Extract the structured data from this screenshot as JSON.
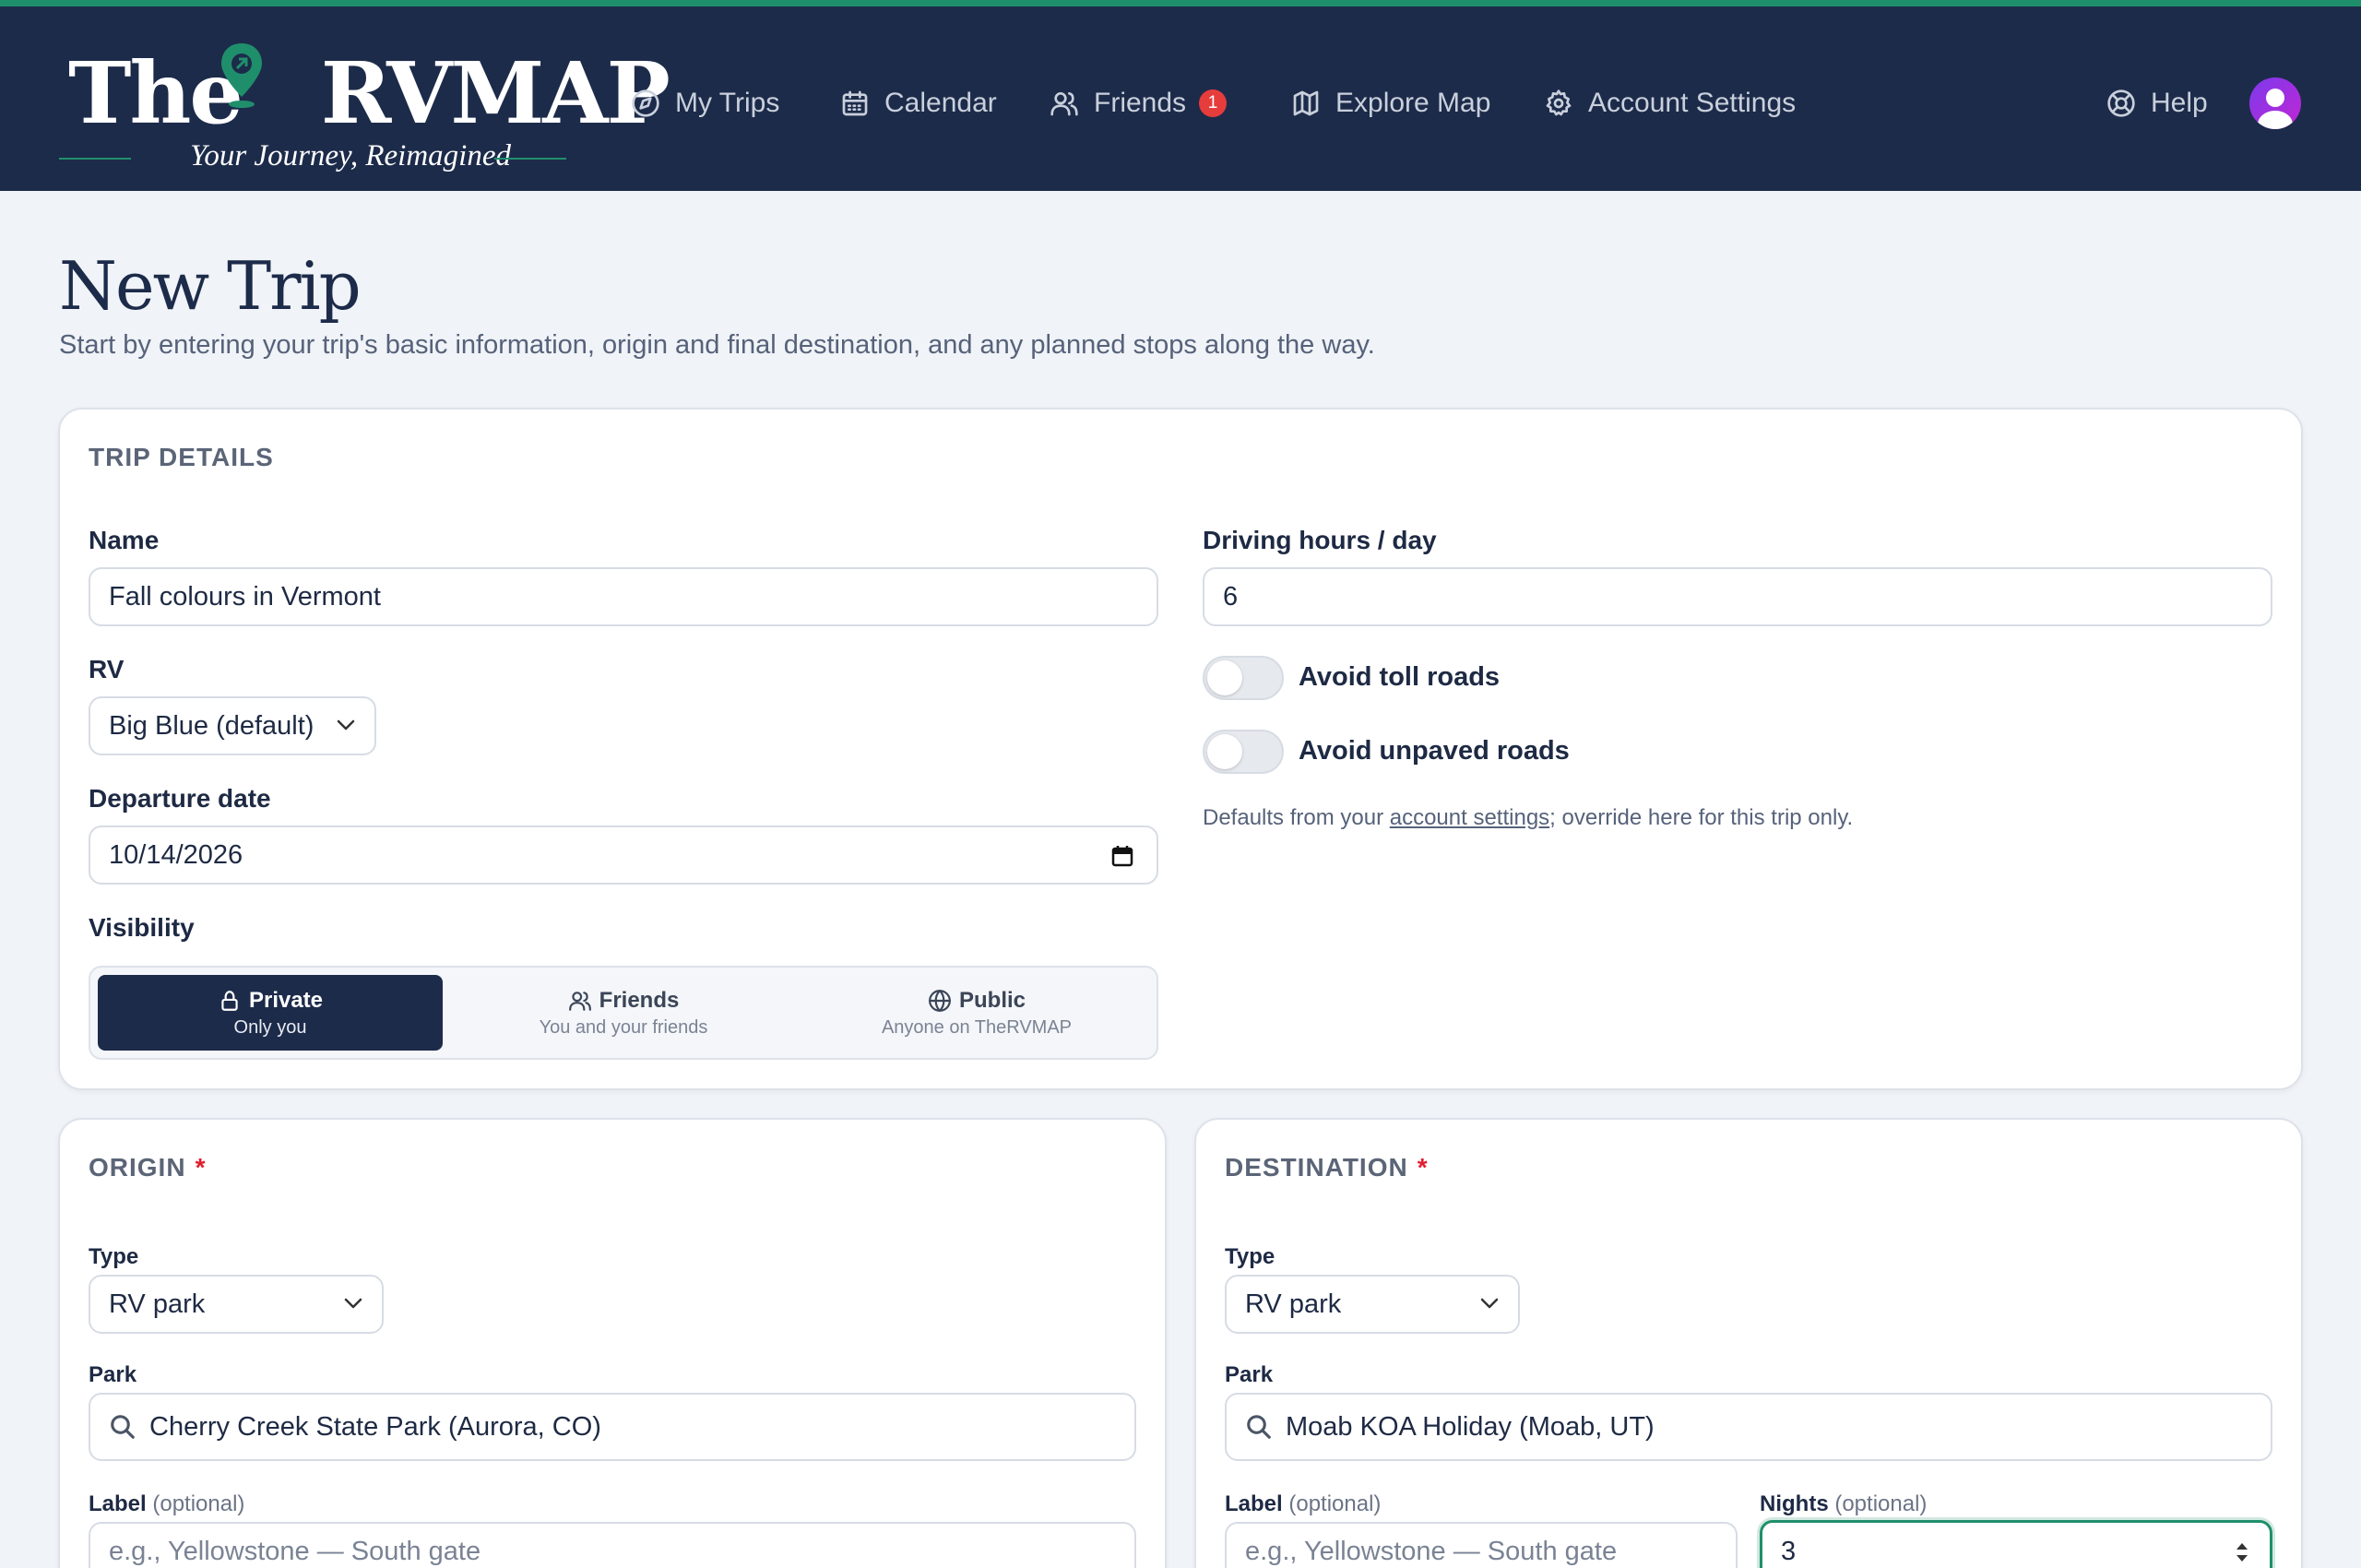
{
  "header": {
    "logo": {
      "title_left": "The",
      "title_right": "RVMAP",
      "tagline": "Your Journey, Reimagined"
    },
    "nav": [
      {
        "label": "My Trips",
        "icon": "compass-icon"
      },
      {
        "label": "Calendar",
        "icon": "calendar-icon"
      },
      {
        "label": "Friends",
        "icon": "users-icon",
        "badge": "1"
      },
      {
        "label": "Explore Map",
        "icon": "map-icon"
      },
      {
        "label": "Account Settings",
        "icon": "gear-icon"
      }
    ],
    "help_label": "Help",
    "colors": {
      "nav_bg": "#1d2b4a",
      "accent": "#1f8f6b",
      "badge": "#e63c3c"
    }
  },
  "page": {
    "title": "New Trip",
    "subtitle": "Start by entering your trip's basic information, origin and final destination, and any planned stops along the way."
  },
  "trip_details": {
    "title": "TRIP DETAILS",
    "name_label": "Name",
    "name_value": "Fall colours in Vermont",
    "rv_label": "RV",
    "rv_value": "Big Blue (default)",
    "departure_label": "Departure date",
    "departure_value": "10/14/2026",
    "visibility_label": "Visibility",
    "visibility_options": [
      {
        "label": "Private",
        "sub": "Only you",
        "icon": "lock-icon",
        "selected": true
      },
      {
        "label": "Friends",
        "sub": "You and your friends",
        "icon": "users-icon",
        "selected": false
      },
      {
        "label": "Public",
        "sub": "Anyone on TheRVMAP",
        "icon": "globe-icon",
        "selected": false
      }
    ],
    "driving_label": "Driving hours / day",
    "driving_value": "6",
    "avoid_toll_label": "Avoid toll roads",
    "avoid_toll_on": false,
    "avoid_unpaved_label": "Avoid unpaved roads",
    "avoid_unpaved_on": false,
    "note_prefix": "Defaults from your ",
    "note_link": "account settings",
    "note_suffix": "; override here for this trip only."
  },
  "origin": {
    "title": "ORIGIN",
    "required": "*",
    "type_label": "Type",
    "type_value": "RV park",
    "park_label": "Park",
    "park_value": "Cherry Creek State Park (Aurora, CO)",
    "label_label": "Label",
    "optional": "(optional)",
    "label_placeholder": "e.g., Yellowstone — South gate"
  },
  "destination": {
    "title": "DESTINATION",
    "required": "*",
    "type_label": "Type",
    "type_value": "RV park",
    "park_label": "Park",
    "park_value": "Moab KOA Holiday (Moab, UT)",
    "label_label": "Label",
    "optional": "(optional)",
    "label_placeholder": "e.g., Yellowstone — South gate",
    "nights_label": "Nights",
    "nights_value": "3"
  }
}
